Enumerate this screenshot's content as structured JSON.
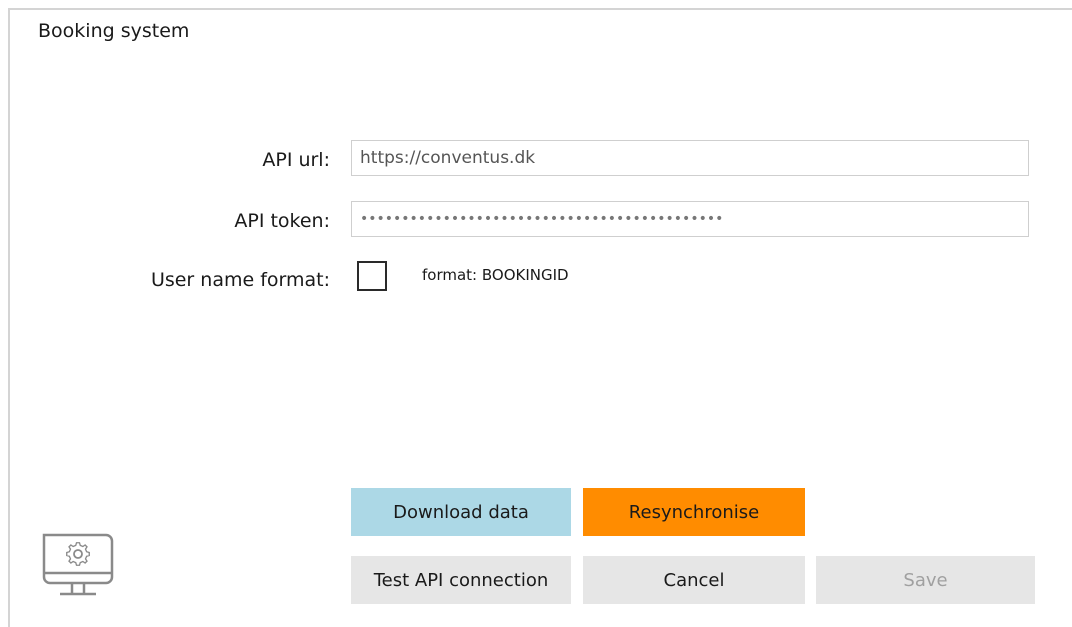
{
  "window": {
    "title": "Booking system"
  },
  "form": {
    "api_url_label": "API url:",
    "api_url_value": "https://conventus.dk",
    "api_token_label": "API token:",
    "api_token_value": "••••••••••••••••••••••••••••••••••••••••••••",
    "user_name_format_label": "User name format:",
    "user_name_format_checked": false,
    "format_hint": "format: BOOKINGID"
  },
  "buttons": {
    "download_label": "Download data",
    "resync_label": "Resynchronise",
    "test_label": "Test API connection",
    "cancel_label": "Cancel",
    "save_label": "Save"
  },
  "icons": {
    "monitor": "monitor-settings-icon"
  },
  "colors": {
    "download_bg": "#acd8e6",
    "resync_bg": "#ff8c00",
    "neutral_bg": "#e6e6e6",
    "disabled_text": "#a0a0a0"
  }
}
